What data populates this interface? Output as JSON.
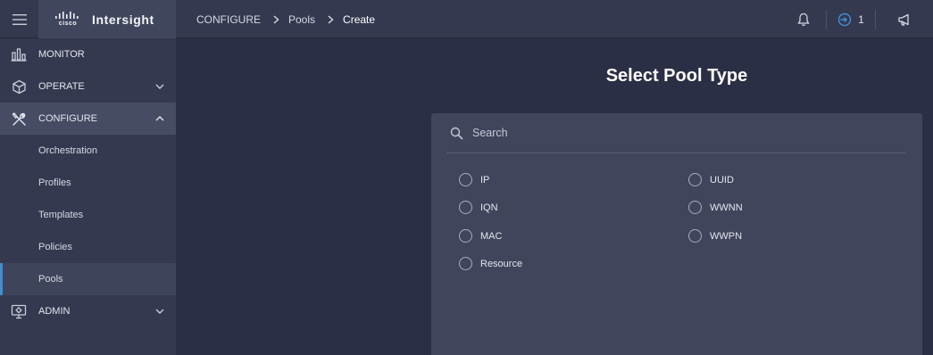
{
  "brand": {
    "vendor": "cisco",
    "product": "Intersight"
  },
  "breadcrumb": {
    "items": [
      "CONFIGURE",
      "Pools",
      "Create"
    ]
  },
  "header": {
    "notification_count": "1"
  },
  "sidebar": {
    "monitor": "MONITOR",
    "operate": "OPERATE",
    "configure": "CONFIGURE",
    "configure_items": [
      "Orchestration",
      "Profiles",
      "Templates",
      "Policies",
      "Pools"
    ],
    "admin": "ADMIN"
  },
  "main": {
    "title": "Select Pool Type",
    "search_placeholder": "Search",
    "options": [
      "IP",
      "IQN",
      "MAC",
      "Resource",
      "UUID",
      "WWNN",
      "WWPN"
    ]
  },
  "icons": {
    "menu": "hamburger-icon",
    "bell": "bell-icon",
    "login": "login-icon",
    "announce": "megaphone-icon",
    "monitor": "bar-chart-icon",
    "operate": "cube-icon",
    "configure": "tools-icon",
    "admin": "monitor-gear-icon",
    "search": "search-icon"
  },
  "colors": {
    "accent": "#3f8fd4",
    "background": "#2a2f45",
    "panel": "#40455c",
    "sidebar": "#34394f"
  }
}
